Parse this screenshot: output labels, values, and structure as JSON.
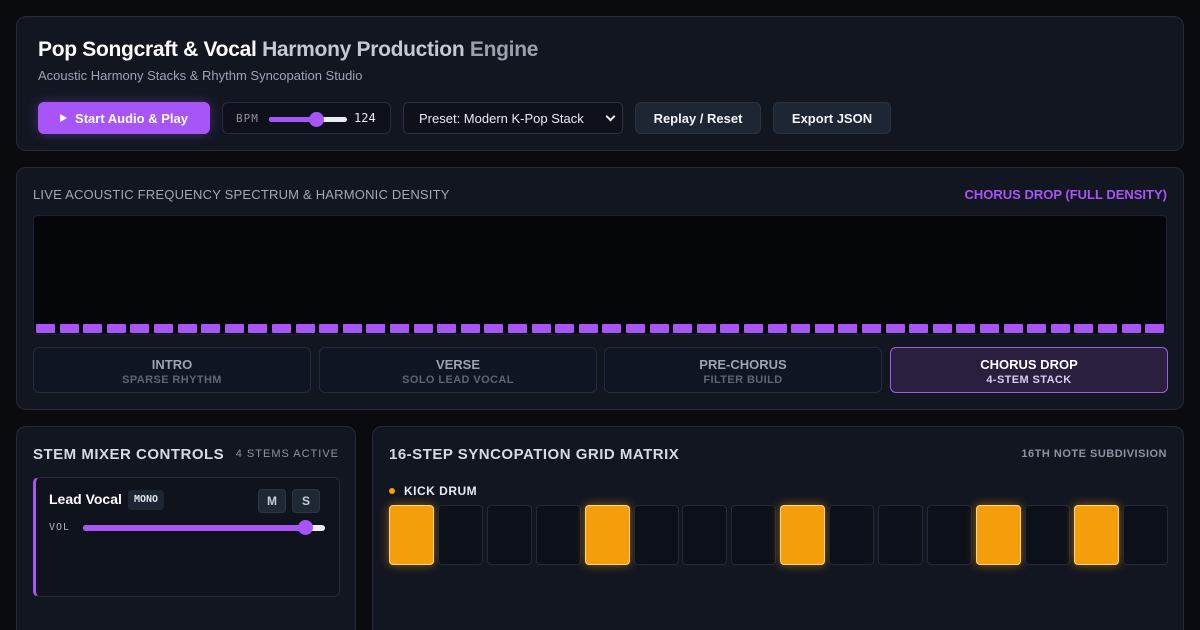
{
  "header": {
    "title_part1": "Pop Songcraft & Vocal",
    "title_part2": "Harmony Production",
    "title_part3": "Engine",
    "subtitle": "Acoustic Harmony Stacks & Rhythm Syncopation Studio",
    "play_label": "Start Audio & Play",
    "bpm_label": "BPM",
    "bpm_value": "124",
    "bpm_slider_fraction": 0.6,
    "preset_label": "Preset: Modern K-Pop Stack",
    "replay_label": "Replay / Reset",
    "export_label": "Export JSON"
  },
  "spectrum": {
    "heading": "LIVE ACOUSTIC FREQUENCY SPECTRUM & HARMONIC DENSITY",
    "status": "CHORUS DROP (FULL DENSITY)",
    "bar_count": 48,
    "bar_color": "#a855f7",
    "sections": [
      {
        "name": "INTRO",
        "sub": "SPARSE RHYTHM",
        "active": false
      },
      {
        "name": "VERSE",
        "sub": "SOLO LEAD VOCAL",
        "active": false
      },
      {
        "name": "PRE-CHORUS",
        "sub": "FILTER BUILD",
        "active": false
      },
      {
        "name": "CHORUS DROP",
        "sub": "4-STEM STACK",
        "active": true
      }
    ]
  },
  "mixer": {
    "heading": "STEM MIXER CONTROLS",
    "count": "4 STEMS ACTIVE",
    "stem": {
      "name": "Lead Vocal",
      "badge": "MONO",
      "mute_label": "M",
      "solo_label": "S",
      "vol_label": "VOL",
      "volume_fraction": 0.92,
      "accent": "#a855f7"
    }
  },
  "sequencer": {
    "heading": "16-STEP SYNCOPATION GRID MATRIX",
    "subdivision": "16TH NOTE SUBDIVISION",
    "track_name": "KICK DRUM",
    "track_color": "#f59e0b",
    "steps": [
      1,
      0,
      0,
      0,
      1,
      0,
      0,
      0,
      1,
      0,
      0,
      0,
      1,
      0,
      1,
      0
    ]
  }
}
